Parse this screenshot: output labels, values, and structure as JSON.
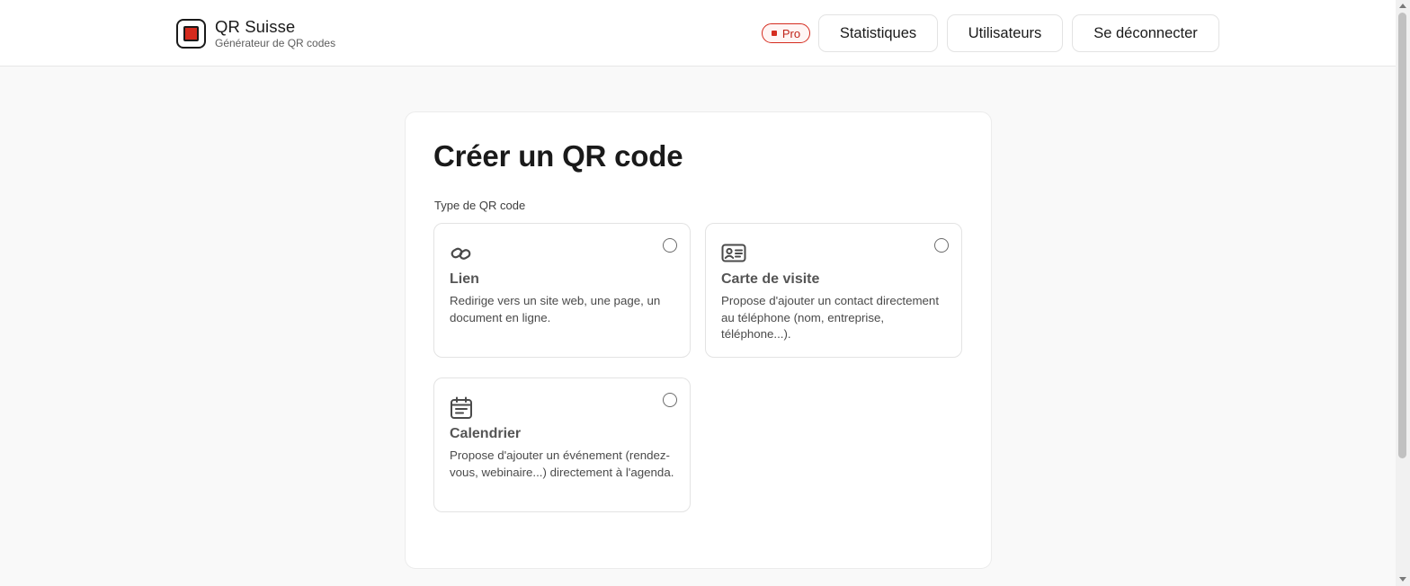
{
  "header": {
    "brand_title": "QR Suisse",
    "brand_subtitle": "Générateur de QR codes",
    "logo_icon": "swiss-square-icon",
    "plan_badge": "Pro",
    "nav": {
      "stats_label": "Statistiques",
      "users_label": "Utilisateurs",
      "logout_label": "Se déconnecter"
    }
  },
  "main": {
    "title": "Créer un QR code",
    "type_label": "Type de QR code",
    "options": [
      {
        "icon": "link-icon",
        "title": "Lien",
        "description": "Redirige vers un site web, une page, un document en ligne.",
        "selected": false
      },
      {
        "icon": "contact-card-icon",
        "title": "Carte de visite",
        "description": "Propose d'ajouter un contact directement au téléphone (nom, entreprise, téléphone...).",
        "selected": false
      },
      {
        "icon": "calendar-icon",
        "title": "Calendrier",
        "description": "Propose d'ajouter un événement (rendez-vous, webinaire...) directement à l'agenda.",
        "selected": false
      }
    ]
  },
  "colors": {
    "accent": "#d52b1e",
    "background": "#f9f9f9",
    "card": "#ffffff",
    "border": "#e3e3e3"
  }
}
